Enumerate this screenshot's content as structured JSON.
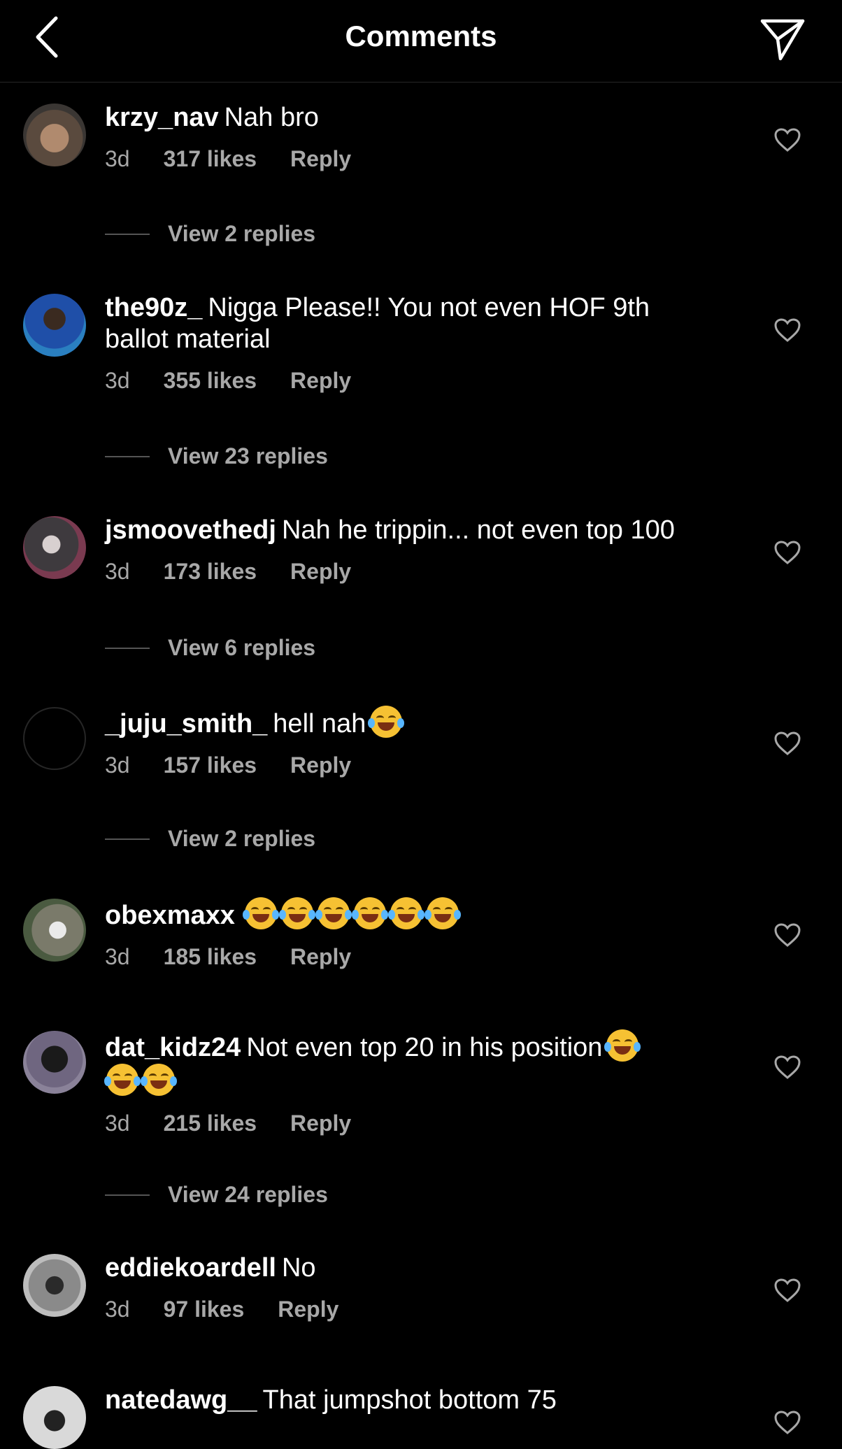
{
  "header": {
    "title": "Comments",
    "back_icon": "chevron-left-icon",
    "send_icon": "paper-plane-icon"
  },
  "comments": [
    {
      "user": "krzy_nav",
      "text": "Nah bro",
      "time": "3d",
      "likes": "317 likes",
      "reply": "Reply",
      "view_replies": "View 2 replies",
      "avatar_color": "#6b5a4e"
    },
    {
      "user": "the90z_",
      "text": "Nigga Please!! You not even HOF 9th ballot material",
      "time": "3d",
      "likes": "355 likes",
      "reply": "Reply",
      "view_replies": "View 23 replies",
      "avatar_color": "#1f4fa8"
    },
    {
      "user": "jsmoovethedj",
      "text": "Nah he trippin... not even top 100",
      "time": "3d",
      "likes": "173 likes",
      "reply": "Reply",
      "view_replies": "View 6 replies",
      "avatar_color": "#5b5560"
    },
    {
      "user": "_juju_smith_",
      "text": "hell nah",
      "time": "3d",
      "likes": "157 likes",
      "reply": "Reply",
      "view_replies": "View 2 replies",
      "avatar_color": "#000000"
    },
    {
      "user": "obexmaxx",
      "text": "",
      "time": "3d",
      "likes": "185 likes",
      "reply": "Reply",
      "view_replies": "",
      "avatar_color": "#7a7a6a"
    },
    {
      "user": "dat_kidz24",
      "text": "Not even top 20 in his position",
      "time": "3d",
      "likes": "215 likes",
      "reply": "Reply",
      "view_replies": "View 24 replies",
      "avatar_color": "#6f6680"
    },
    {
      "user": "eddiekoardell",
      "text": "No",
      "time": "3d",
      "likes": "97 likes",
      "reply": "Reply",
      "view_replies": "",
      "avatar_color": "#8a8a8a"
    },
    {
      "user": "natedawg__",
      "text": "That jumpshot bottom 75",
      "time": "",
      "likes": "",
      "reply": "",
      "view_replies": "",
      "avatar_color": "#d9d9d9"
    }
  ],
  "colors": {
    "background": "#000000",
    "text": "#ffffff",
    "meta": "#a8a8a8",
    "divider": "#262626"
  }
}
